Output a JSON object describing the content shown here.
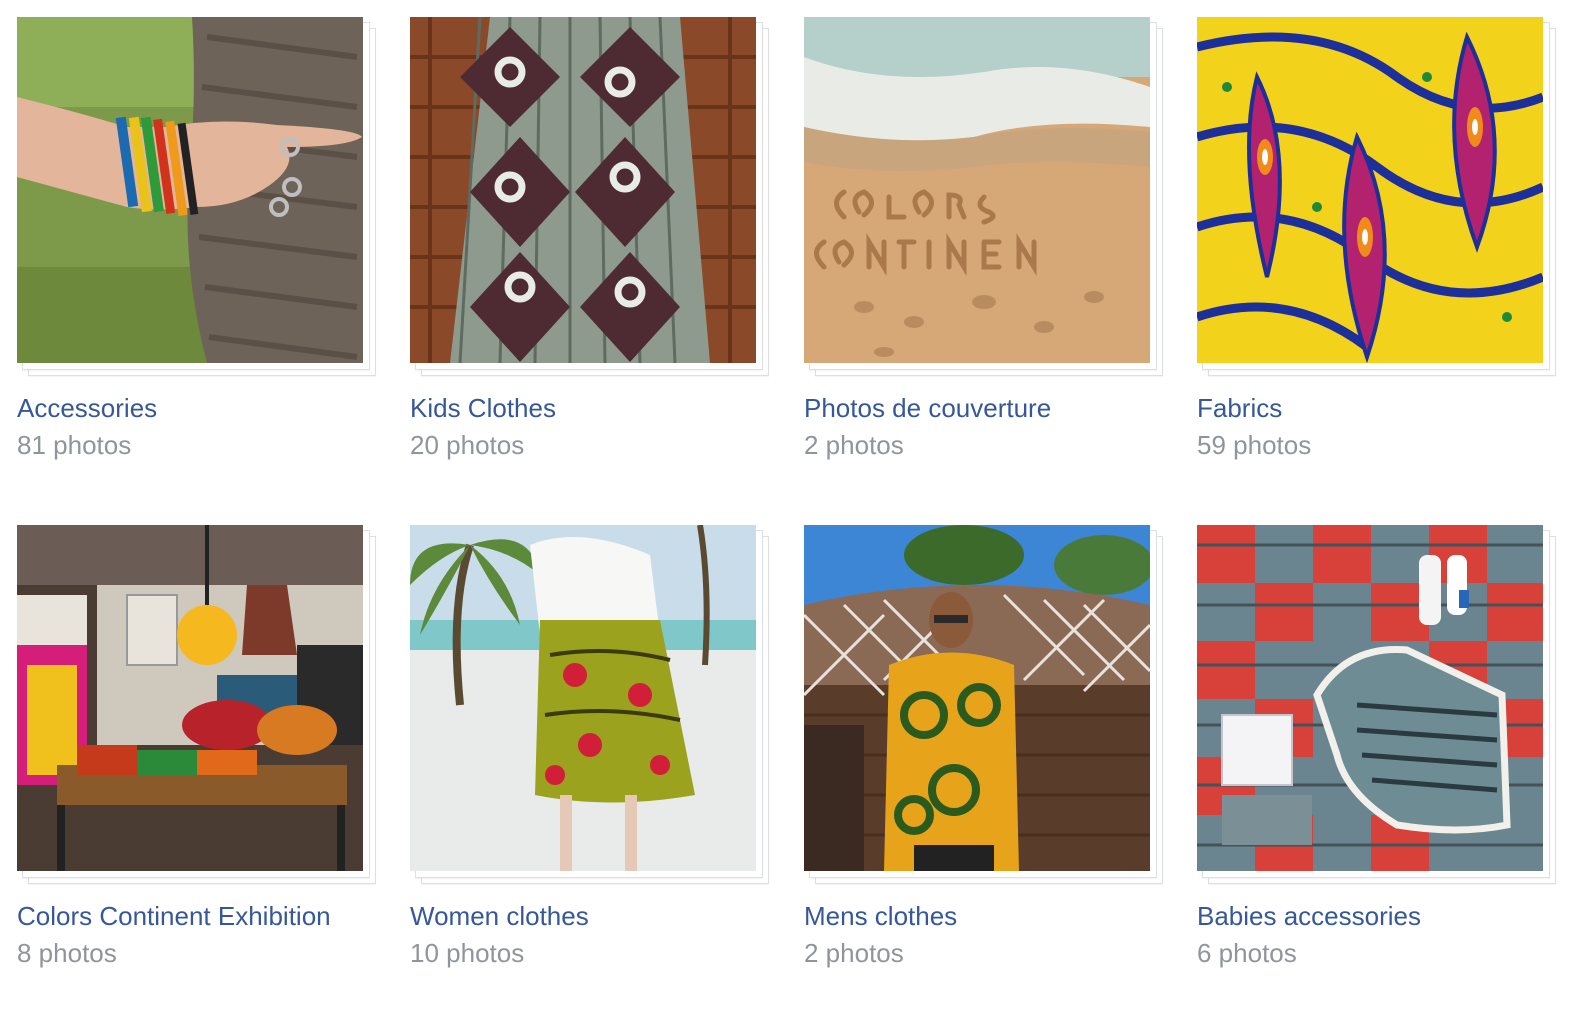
{
  "albums": [
    {
      "title": "Accessories",
      "count": "81 photos",
      "cover": "hand-with-bracelets-on-palm-tree"
    },
    {
      "title": "Kids Clothes",
      "count": "20 photos",
      "cover": "patterned-dress-on-wooden-deck"
    },
    {
      "title": "Photos de couverture",
      "count": "2 photos",
      "cover": "sand-writing-colors-continent"
    },
    {
      "title": "Fabrics",
      "count": "59 photos",
      "cover": "yellow-blue-wax-print-fabric"
    },
    {
      "title": "Colors Continent Exhibition",
      "count": "8 photos",
      "cover": "exhibition-stand-with-bags"
    },
    {
      "title": "Women clothes",
      "count": "10 photos",
      "cover": "woman-skirt-on-beach"
    },
    {
      "title": "Mens clothes",
      "count": "2 photos",
      "cover": "man-in-yellow-african-shirt"
    },
    {
      "title": "Babies accessories",
      "count": "6 photos",
      "cover": "baby-bib-on-patchwork-quilt"
    }
  ]
}
